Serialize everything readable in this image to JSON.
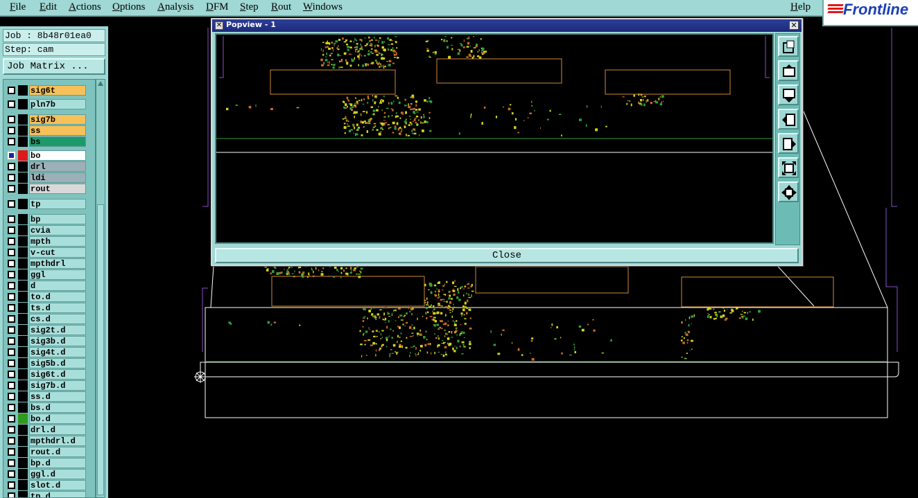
{
  "menubar": {
    "items": [
      "File",
      "Edit",
      "Actions",
      "Options",
      "Analysis",
      "DFM",
      "Step",
      "Rout",
      "Windows"
    ],
    "help": "Help",
    "logo": "Frontline"
  },
  "left_panel": {
    "job_line": "Job : 8b48r01ea0",
    "step_line": "Step: cam",
    "job_matrix_label": "Job Matrix ..."
  },
  "layers": [
    {
      "name": "sig6t",
      "color": "#000000",
      "name_bg": "#f7c15a",
      "active": false
    },
    {
      "name": "pln7b",
      "color": "#000000",
      "name_bg": "#a9dfdb",
      "active": false
    },
    {
      "name": "sig7b",
      "color": "#000000",
      "name_bg": "#f7c15a",
      "active": false
    },
    {
      "name": "ss",
      "color": "#000000",
      "name_bg": "#f7c15a",
      "active": false
    },
    {
      "name": "bs",
      "color": "#000000",
      "name_bg": "#1e9a6a",
      "active": false
    },
    {
      "name": "bo",
      "color": "#e01818",
      "name_bg": "#ffffff",
      "active": true
    },
    {
      "name": "drl",
      "color": "#000000",
      "name_bg": "#9cb0b8",
      "active": false
    },
    {
      "name": "ldi",
      "color": "#000000",
      "name_bg": "#9cb0b8",
      "active": false
    },
    {
      "name": "rout",
      "color": "#000000",
      "name_bg": "#d9d9d9",
      "active": false
    },
    {
      "name": "tp",
      "color": "#000000",
      "name_bg": "#a9dfdb",
      "active": false
    },
    {
      "name": "bp",
      "color": "#000000",
      "name_bg": "#a9dfdb",
      "active": false
    },
    {
      "name": "cvia",
      "color": "#000000",
      "name_bg": "#a9dfdb",
      "active": false
    },
    {
      "name": "mpth",
      "color": "#000000",
      "name_bg": "#a9dfdb",
      "active": false
    },
    {
      "name": "v-cut",
      "color": "#000000",
      "name_bg": "#a9dfdb",
      "active": false
    },
    {
      "name": "mpthdrl",
      "color": "#000000",
      "name_bg": "#a9dfdb",
      "active": false
    },
    {
      "name": "ggl",
      "color": "#000000",
      "name_bg": "#a9dfdb",
      "active": false
    },
    {
      "name": "d",
      "color": "#000000",
      "name_bg": "#a9dfdb",
      "active": false
    },
    {
      "name": "to.d",
      "color": "#000000",
      "name_bg": "#a9dfdb",
      "active": false
    },
    {
      "name": "ts.d",
      "color": "#000000",
      "name_bg": "#a9dfdb",
      "active": false
    },
    {
      "name": "cs.d",
      "color": "#000000",
      "name_bg": "#a9dfdb",
      "active": false
    },
    {
      "name": "sig2t.d",
      "color": "#000000",
      "name_bg": "#a9dfdb",
      "active": false
    },
    {
      "name": "sig3b.d",
      "color": "#000000",
      "name_bg": "#a9dfdb",
      "active": false
    },
    {
      "name": "sig4t.d",
      "color": "#000000",
      "name_bg": "#a9dfdb",
      "active": false
    },
    {
      "name": "sig5b.d",
      "color": "#000000",
      "name_bg": "#a9dfdb",
      "active": false
    },
    {
      "name": "sig6t.d",
      "color": "#000000",
      "name_bg": "#a9dfdb",
      "active": false
    },
    {
      "name": "sig7b.d",
      "color": "#000000",
      "name_bg": "#a9dfdb",
      "active": false
    },
    {
      "name": "ss.d",
      "color": "#000000",
      "name_bg": "#a9dfdb",
      "active": false
    },
    {
      "name": "bs.d",
      "color": "#000000",
      "name_bg": "#a9dfdb",
      "active": false
    },
    {
      "name": "bo.d",
      "color": "#2e9a1e",
      "name_bg": "#a9dfdb",
      "active": false
    },
    {
      "name": "drl.d",
      "color": "#000000",
      "name_bg": "#a9dfdb",
      "active": false
    },
    {
      "name": "mpthdrl.d",
      "color": "#000000",
      "name_bg": "#a9dfdb",
      "active": false
    },
    {
      "name": "rout.d",
      "color": "#000000",
      "name_bg": "#a9dfdb",
      "active": false
    },
    {
      "name": "bp.d",
      "color": "#000000",
      "name_bg": "#a9dfdb",
      "active": false
    },
    {
      "name": "ggl.d",
      "color": "#000000",
      "name_bg": "#a9dfdb",
      "active": false
    },
    {
      "name": "slot.d",
      "color": "#000000",
      "name_bg": "#a9dfdb",
      "active": false
    },
    {
      "name": "tp.d",
      "color": "#000000",
      "name_bg": "#a9dfdb",
      "active": false
    }
  ],
  "popview": {
    "title": "Popview - 1",
    "close_label": "Close",
    "tools": [
      "zoom-window-icon",
      "page-up-icon",
      "page-down-icon",
      "page-left-icon",
      "page-right-icon",
      "zoom-fit-icon",
      "zoom-center-icon"
    ]
  },
  "colors": {
    "panel": "#9fd8d4",
    "board_outline": "#ffffff",
    "component_outline": "#d08a3a",
    "pad_yellow": "#d4d41a",
    "pad_green": "#2ea040",
    "profile_purple": "#8a4fc8"
  }
}
